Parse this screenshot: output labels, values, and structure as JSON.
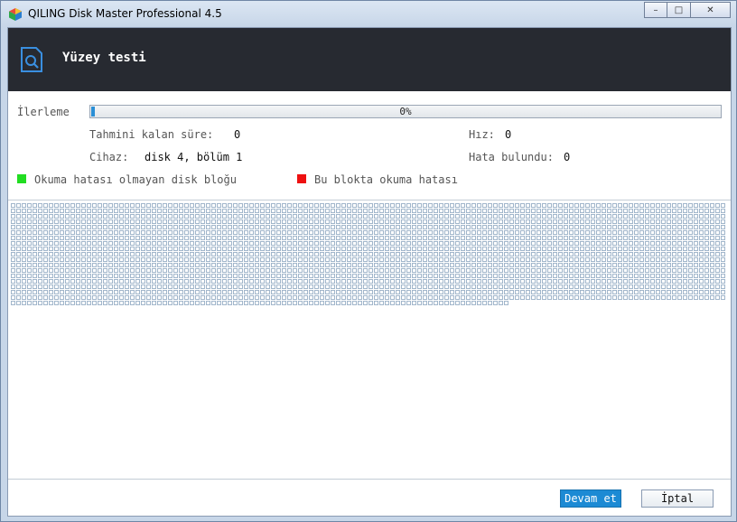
{
  "window": {
    "title": "QILING Disk Master Professional 4.5",
    "controls": {
      "minimize": "–",
      "maximize": "□",
      "close": "✕"
    }
  },
  "header": {
    "title": "Yüzey testi",
    "icon": "surface-test-icon",
    "background": "#272a31"
  },
  "progress": {
    "label": "İlerleme",
    "text": "0%",
    "fraction": 0.005,
    "color": "#2a8fd6"
  },
  "stats": {
    "remaining_label": "Tahmini kalan süre:",
    "remaining_value": "0",
    "speed_label": "Hız:",
    "speed_value": "0",
    "device_label": "Cihaz:",
    "device_value": "disk 4, bölüm 1",
    "errors_label": "Hata bulundu:",
    "errors_value": "0"
  },
  "legend": {
    "ok_label": "Okuma hatası olmayan disk bloğu",
    "ok_color": "#22dd22",
    "error_label": "Bu blokta okuma hatası",
    "error_color": "#ee1111"
  },
  "blocks": {
    "total": 2468,
    "untested_color": "#8aa4bf"
  },
  "buttons": {
    "continue": "Devam et",
    "cancel": "İptal"
  }
}
